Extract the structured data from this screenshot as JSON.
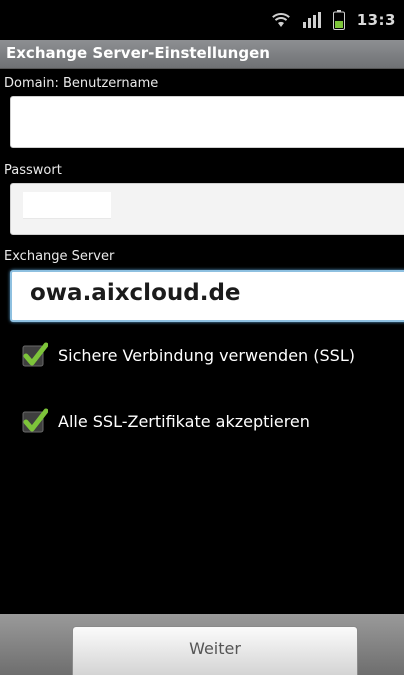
{
  "status_bar": {
    "time": "13:3",
    "icons": [
      "wifi-icon",
      "signal-icon",
      "battery-icon"
    ]
  },
  "header": {
    "title": "Exchange Server-Einstellungen"
  },
  "form": {
    "domain_label": "Domain: Benutzername",
    "domain_value": "",
    "password_label": "Passwort",
    "password_value": "",
    "server_label": "Exchange Server",
    "server_value": "owa.aixcloud.de"
  },
  "options": [
    {
      "label": "Sichere Verbindung verwenden (SSL)",
      "checked": true
    },
    {
      "label": "Alle SSL-Zertifikate akzeptieren",
      "checked": true
    }
  ],
  "footer": {
    "next_label": "Weiter"
  },
  "colors": {
    "check_green": "#7dc43a",
    "focus_blue": "#8ec0e0",
    "title_bar": "#7c7e81"
  }
}
